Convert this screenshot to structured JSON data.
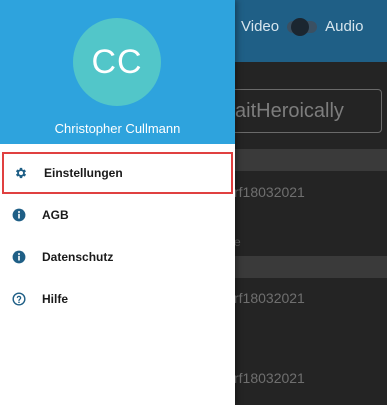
{
  "app": {
    "toggle_left_label": "Video",
    "toggle_right_label": "Audio",
    "search_value": "aitHeroically",
    "list_items": [
      {
        "text": "rf18032021"
      },
      {
        "text": "rf18032021"
      },
      {
        "text": "rf18032021"
      }
    ],
    "small_text": "e"
  },
  "drawer": {
    "avatar_initials": "CC",
    "user_name": "Christopher Cullmann",
    "menu": [
      {
        "label": "Einstellungen",
        "icon": "gear-icon",
        "active": true
      },
      {
        "label": "AGB",
        "icon": "info-icon",
        "active": false
      },
      {
        "label": "Datenschutz",
        "icon": "info-icon",
        "active": false
      },
      {
        "label": "Hilfe",
        "icon": "help-circle-icon",
        "active": false
      }
    ]
  },
  "colors": {
    "drawer_header": "#2ea3dd",
    "avatar": "#52c6c9",
    "active_outline": "#e04040",
    "icon_primary": "#1f5f86"
  }
}
